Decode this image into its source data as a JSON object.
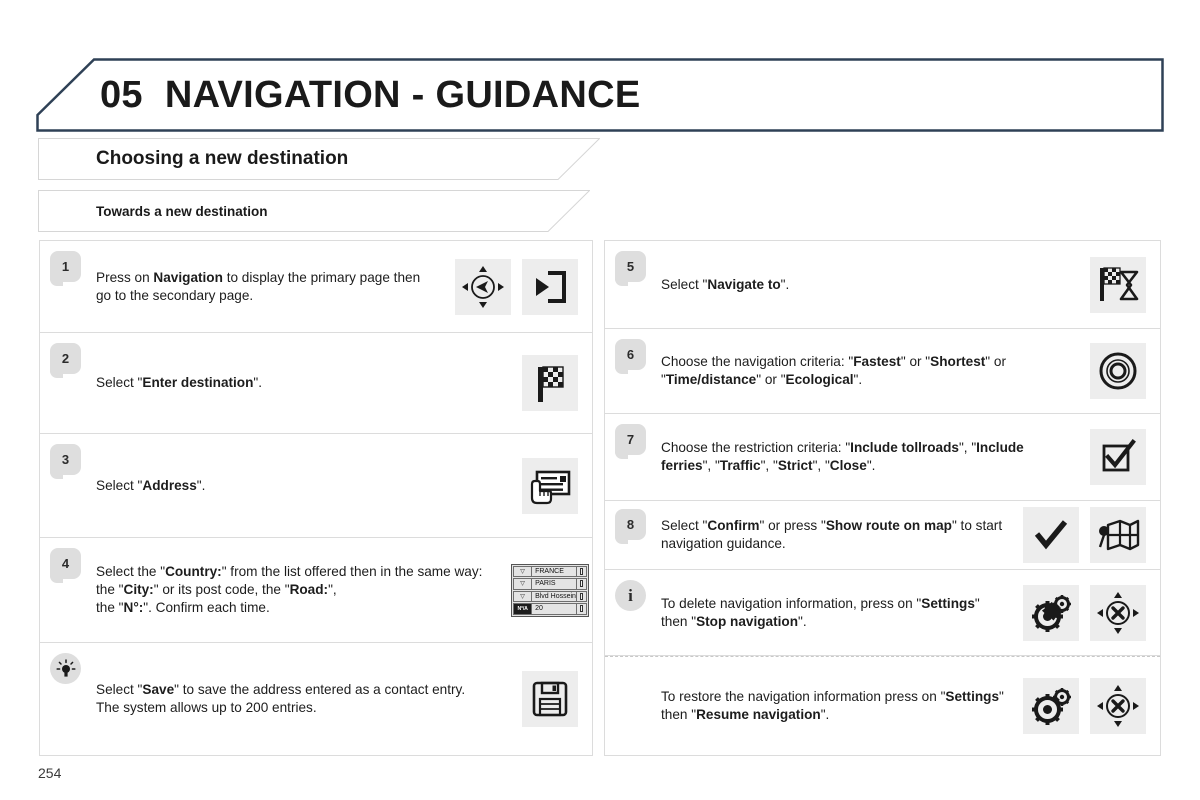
{
  "document": {
    "chapter_number": "05",
    "chapter_title": "NAVIGATION - GUIDANCE",
    "page_number": "254",
    "section_title": "Choosing a new destination",
    "subsection_title": "Towards a new destination",
    "accent_color": "#2f4156",
    "badge_color": "#dedede",
    "icon_tile_color": "#ededed"
  },
  "left_column": {
    "steps": [
      {
        "badge": "1",
        "badge_type": "number",
        "text_html": "Press on <b>Navigation</b> to display the primary page then go to the secondary page.",
        "icons": [
          "navigation-pad-icon",
          "secondary-page-icon"
        ]
      },
      {
        "badge": "2",
        "badge_type": "number",
        "text_html": "Select \"<b>Enter destination</b>\".",
        "icons": [
          "checkered-flag-icon"
        ]
      },
      {
        "badge": "3",
        "badge_type": "number",
        "text_html": "Select \"<b>Address</b>\".",
        "icons": [
          "hand-on-address-card-icon"
        ]
      },
      {
        "badge": "4",
        "badge_type": "number",
        "text_html": "Select the \"<b>Country:</b>\" from the list offered then in the same way:<br>the \"<b>City:</b>\" or its post code, the \"<b>Road:</b>\",<br>the \"<b>N°:</b>\". Confirm each time.",
        "icons": [
          "address-list-widget"
        ]
      },
      {
        "badge": "tip",
        "badge_type": "lightbulb",
        "text_html": "Select \"<b>Save</b>\" to save the address entered as a contact entry.<br>The system allows up to 200 entries.",
        "icons": [
          "floppy-disk-save-icon"
        ]
      }
    ]
  },
  "right_column": {
    "steps": [
      {
        "badge": "5",
        "badge_type": "number",
        "text_html": "Select \"<b>Navigate to</b>\".",
        "icons": [
          "flag-hourglass-icon"
        ]
      },
      {
        "badge": "6",
        "badge_type": "number",
        "text_html": "Choose the navigation criteria: \"<b>Fastest</b>\" or \"<b>Shortest</b>\" or \"<b>Time/distance</b>\" or \"<b>Ecological</b>\".",
        "icons": [
          "target-circles-icon"
        ]
      },
      {
        "badge": "7",
        "badge_type": "number",
        "text_html": "Choose the restriction criteria: \"<b>Include tollroads</b>\", \"<b>Include ferries</b>\", \"<b>Traffic</b>\", \"<b>Strict</b>\", \"<b>Close</b>\".",
        "icons": [
          "checkbox-checked-icon"
        ]
      },
      {
        "badge": "8",
        "badge_type": "number",
        "text_html": "Select \"<b>Confirm</b>\" or press \"<b>Show route on map</b>\" to start navigation guidance.",
        "icons": [
          "checkmark-icon",
          "folded-map-pin-icon"
        ]
      },
      {
        "badge": "i",
        "badge_type": "info",
        "text_html": "To delete navigation information, press on \"<b>Settings</b>\" then \"<b>Stop navigation</b>\".",
        "icons": [
          "gears-settings-icon",
          "compass-cancel-icon"
        ]
      },
      {
        "badge": "",
        "badge_type": "none",
        "text_html": "To restore the navigation information press on \"<b>Settings</b>\" then \"<b>Resume navigation</b>\".",
        "icons": [
          "gears-settings-icon",
          "compass-cancel-icon"
        ]
      }
    ]
  },
  "address_widget": {
    "rows": [
      {
        "key": "▽",
        "key_style": "arrow",
        "value": "FRANCE"
      },
      {
        "key": "▽",
        "key_style": "arrow",
        "value": "PARIS"
      },
      {
        "key": "▽",
        "key_style": "arrow",
        "value": "Blvd Hossein"
      },
      {
        "key": "N°/A",
        "key_style": "dark",
        "value": "20"
      }
    ]
  }
}
